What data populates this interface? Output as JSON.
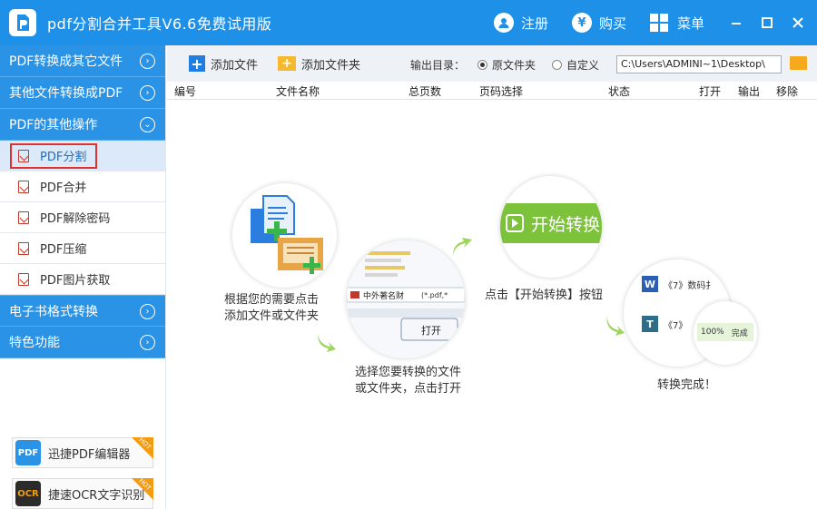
{
  "titlebar": {
    "title": "pdf分割合并工具V6.6免费试用版",
    "register": "注册",
    "buy": "购买",
    "menu": "菜单"
  },
  "sidebar": {
    "categories": [
      {
        "label": "PDF转换成其它文件"
      },
      {
        "label": "其他文件转换成PDF"
      },
      {
        "label": "PDF的其他操作"
      }
    ],
    "subitems": [
      {
        "label": "PDF分割"
      },
      {
        "label": "PDF合并"
      },
      {
        "label": "PDF解除密码"
      },
      {
        "label": "PDF压缩"
      },
      {
        "label": "PDF图片获取"
      }
    ],
    "categories_bottom": [
      {
        "label": "电子书格式转换"
      },
      {
        "label": "特色功能"
      }
    ],
    "promos": [
      {
        "label": "迅捷PDF编辑器",
        "icon_text": "PDF",
        "badge": "HOT"
      },
      {
        "label": "捷速OCR文字识别",
        "icon_text": "OCR",
        "badge": "HOT"
      }
    ]
  },
  "toolbar": {
    "add_file": "添加文件",
    "add_folder": "添加文件夹",
    "output_label": "输出目录：",
    "option_original": "原文件夹",
    "option_custom": "自定义",
    "path": "C:\\Users\\ADMINI~1\\Desktop\\"
  },
  "table": {
    "headers": [
      "编号",
      "文件名称",
      "总页数",
      "页码选择",
      "状态",
      "打开",
      "输出",
      "移除"
    ]
  },
  "guide": {
    "step1": "根据您的需要点击\n添加文件或文件夹",
    "step2": "选择您要转换的文件\n或文件夹，点击打开",
    "step3": "点击【开始转换】按钮",
    "step4": "转换完成！",
    "start_button": "开始转换",
    "dialog_filename": "中外著名财",
    "dialog_filter": "(*.pdf,*",
    "dialog_open": "打开",
    "done_item1": "《7》数码扌",
    "done_item2": "《7》",
    "done_progress": "100%",
    "done_status": "完成"
  },
  "colors": {
    "titlebar": "#1e90e8",
    "sidebar_category": "#2a93e6",
    "accent_green": "#7cc23a",
    "highlight_border": "#e03131"
  }
}
